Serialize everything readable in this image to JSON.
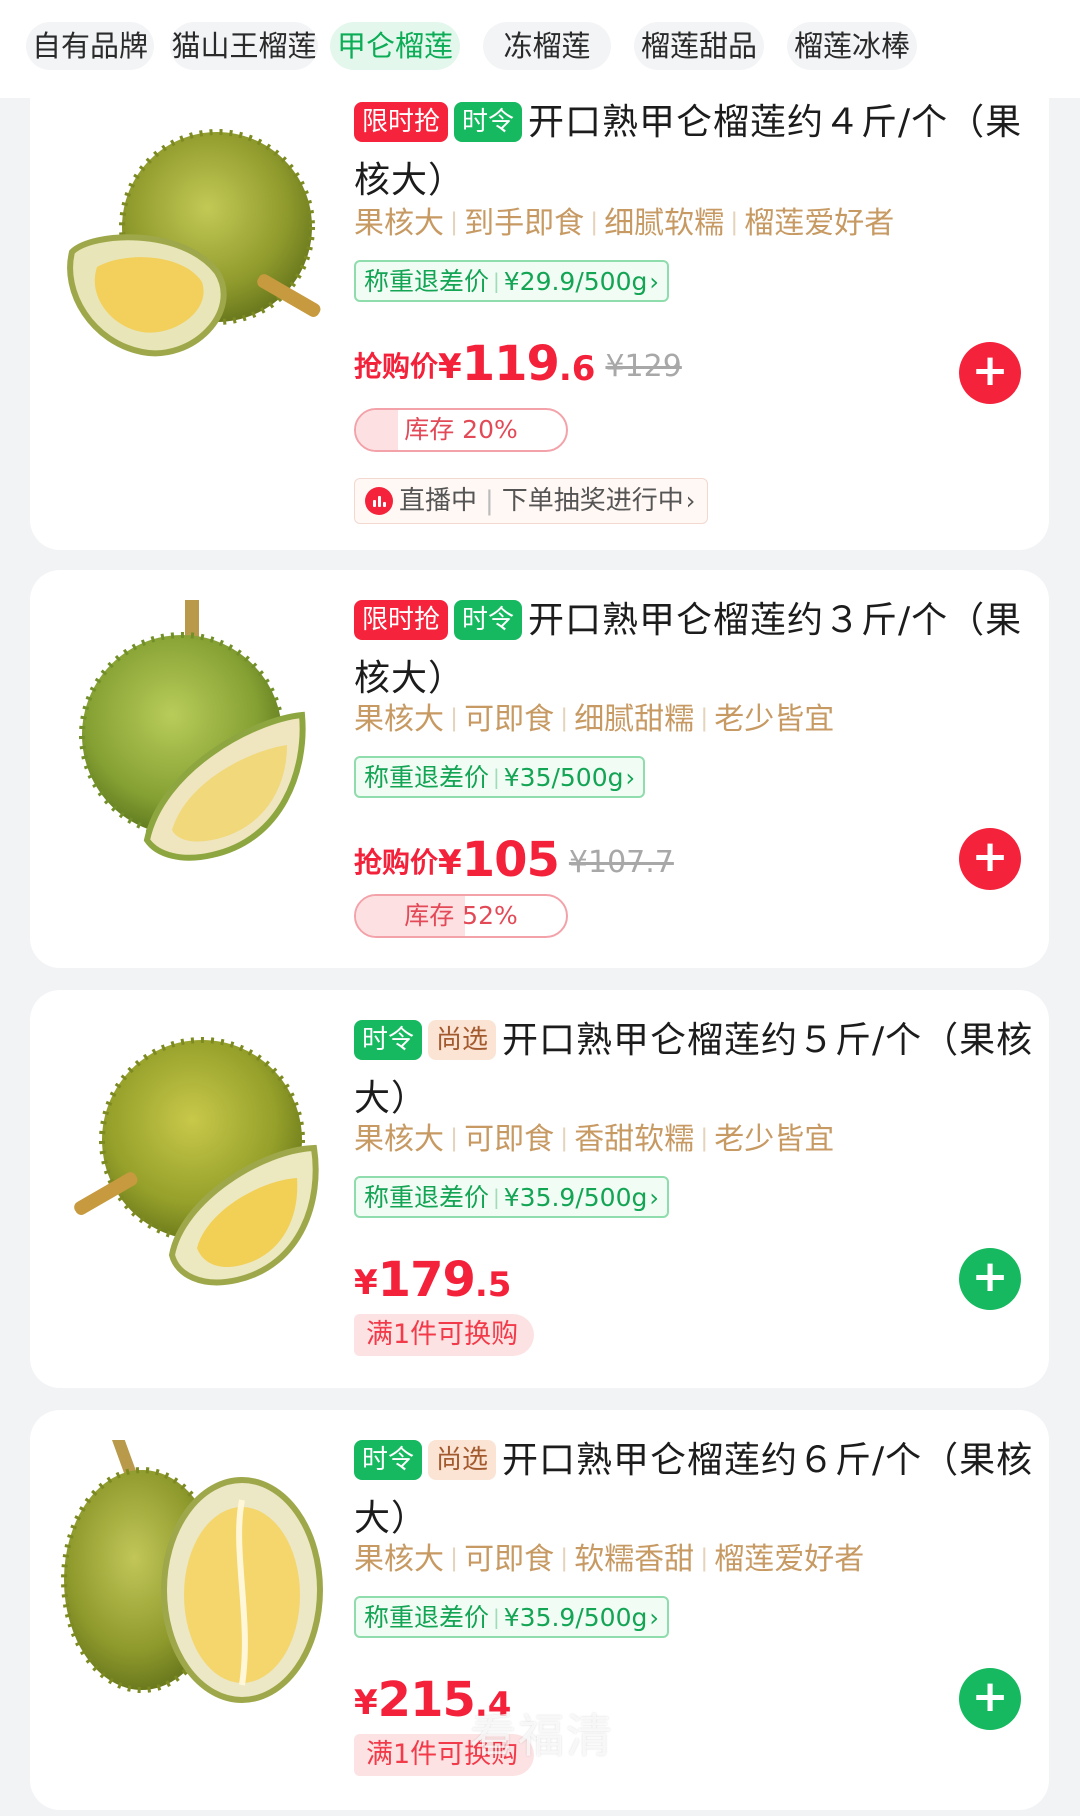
{
  "category_tabs": [
    {
      "label": "自有品牌",
      "active": false
    },
    {
      "label": "猫山王榴莲",
      "active": false
    },
    {
      "label": "甲仑榴莲",
      "active": true
    },
    {
      "label": "冻榴莲",
      "active": false
    },
    {
      "label": "榴莲甜品",
      "active": false
    },
    {
      "label": "榴莲冰棒",
      "active": false
    }
  ],
  "products": [
    {
      "badges": [
        "限时抢",
        "时令"
      ],
      "title": "开口熟甲仑榴莲约４斤/个（果核大）",
      "tags": [
        "果核大",
        "到手即食",
        "细腻软糯",
        "榴莲爱好者"
      ],
      "unit_price_label": "称重退差价",
      "unit_price": "¥29.9/500g",
      "price_label": "抢购价",
      "price_int": "119",
      "price_dec": ".6",
      "original_price": "¥129",
      "stock_text": "库存 20%",
      "stock_percent": 20,
      "live_text": "直播中",
      "live_sub": "下单抽奖进行中",
      "add_icon": "plus-icon"
    },
    {
      "badges": [
        "限时抢",
        "时令"
      ],
      "title": "开口熟甲仑榴莲约３斤/个（果核大）",
      "tags": [
        "果核大",
        "可即食",
        "细腻甜糯",
        "老少皆宜"
      ],
      "unit_price_label": "称重退差价",
      "unit_price": "¥35/500g",
      "price_label": "抢购价",
      "price_int": "105",
      "price_dec": "",
      "original_price": "¥107.7",
      "stock_text": "库存 52%",
      "stock_percent": 52,
      "add_icon": "plus-icon"
    },
    {
      "badges": [
        "时令",
        "尚选"
      ],
      "title": "开口熟甲仑榴莲约５斤/个（果核大）",
      "tags": [
        "果核大",
        "可即食",
        "香甜软糯",
        "老少皆宜"
      ],
      "unit_price_label": "称重退差价",
      "unit_price": "¥35.9/500g",
      "price_int": "179",
      "price_dec": ".5",
      "promo_text": "满1件可换购",
      "add_icon": "plus-icon"
    },
    {
      "badges": [
        "时令",
        "尚选"
      ],
      "title": "开口熟甲仑榴莲约６斤/个（果核大）",
      "tags": [
        "果核大",
        "可即食",
        "软糯香甜",
        "榴莲爱好者"
      ],
      "unit_price_label": "称重退差价",
      "unit_price": "¥35.9/500g",
      "price_int": "215",
      "price_dec": ".4",
      "promo_text": "满1件可换购",
      "add_icon": "plus-icon"
    }
  ],
  "currency_symbol": "¥",
  "chevron": "›",
  "watermark": "看福清",
  "colors": {
    "accent_green": "#16b95f",
    "accent_red": "#f4233b",
    "tag_brown": "#c79a63",
    "background": "#f2f3f5"
  }
}
